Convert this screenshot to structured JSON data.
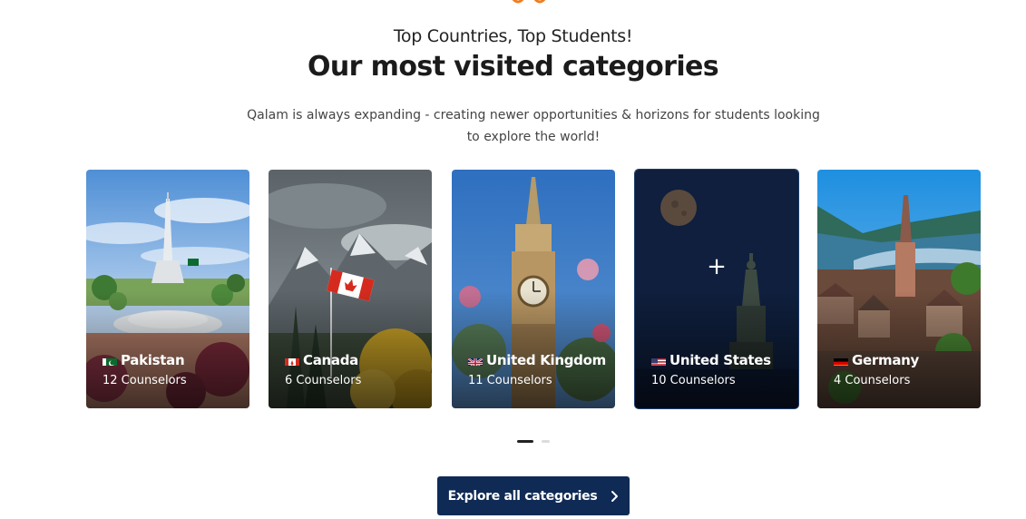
{
  "section": {
    "eyebrow": "Top Countries, Top Students!",
    "title": "Our most visited categories",
    "description": "Qalam is always expanding - creating newer opportunities & horizons for students looking to explore the world!"
  },
  "categories": [
    {
      "name": "Pakistan",
      "counselors": "12 Counselors",
      "flag": "pakistan-flag"
    },
    {
      "name": "Canada",
      "counselors": "6 Counselors",
      "flag": "canada-flag"
    },
    {
      "name": "United Kingdom",
      "counselors": "11 Counselors",
      "flag": "uk-flag"
    },
    {
      "name": "United States",
      "counselors": "10 Counselors",
      "flag": "us-flag"
    },
    {
      "name": "Germany",
      "counselors": "4 Counselors",
      "flag": "germany-flag"
    }
  ],
  "carousel": {
    "pages": 2,
    "active_page": 1
  },
  "cta": {
    "label": "Explore all categories",
    "icon": "chevron-right-icon"
  },
  "colors": {
    "accent": "#f07c1e",
    "primary": "#0f2a55",
    "active_card_border": "#1c3d6b"
  }
}
